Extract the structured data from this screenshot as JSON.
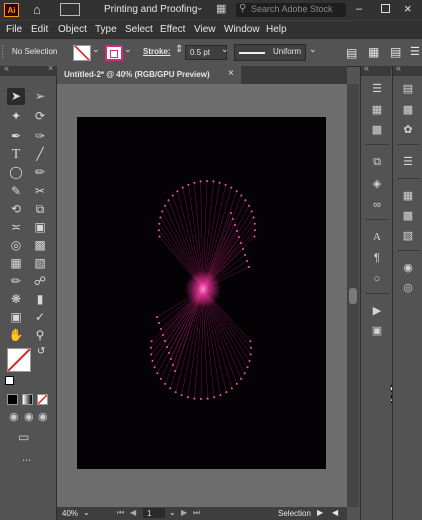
{
  "app": {
    "logo": "Ai",
    "workspace": "Printing and Proofing",
    "search_placeholder": "Search Adobe Stock"
  },
  "menu": [
    "File",
    "Edit",
    "Object",
    "Type",
    "Select",
    "Effect",
    "View",
    "Window",
    "Help"
  ],
  "control": {
    "selection_label": "No Selection",
    "stroke_label": "Stroke:",
    "stroke_value": "0.5 pt",
    "profile": "Uniform"
  },
  "document": {
    "tab_title": "Untitled-2* @ 40% (RGB/GPU Preview)",
    "close": "×"
  },
  "status": {
    "zoom": "40%",
    "artboard_num": "1",
    "tool_name": "Selection"
  },
  "icons": {
    "home": "home-icon",
    "search": "search-icon",
    "collapse": "chevrons-icon",
    "accent_fill": "#d12b7b"
  },
  "colors": {
    "art_glow": "#ff3aa8",
    "art_line": "#b8206e"
  },
  "toolbar_more": "..."
}
